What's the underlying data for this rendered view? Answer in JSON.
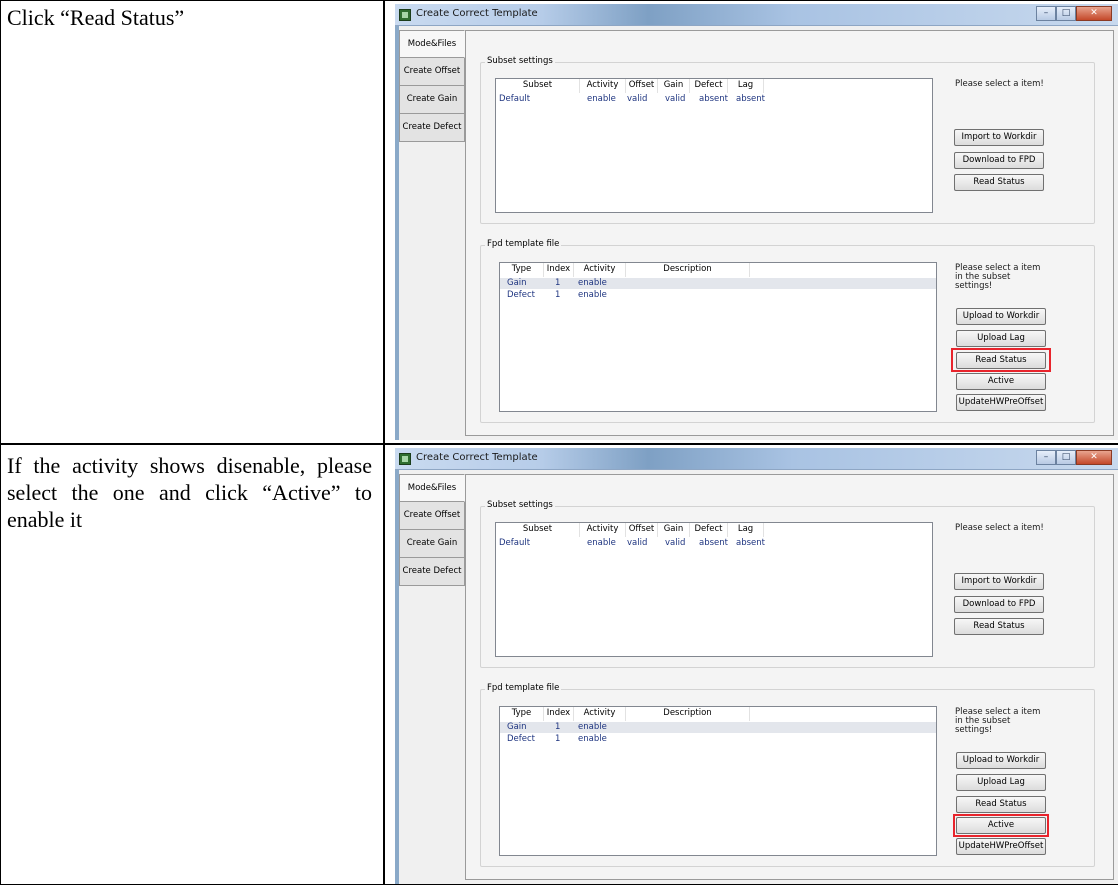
{
  "rows": [
    {
      "instruction": "Click “Read Status”"
    },
    {
      "instruction": "If the activity shows disenable, please select the one and click “Active” to enable it"
    }
  ],
  "window": {
    "title": "Create Correct Template",
    "controls": {
      "minimize": "–",
      "maximize": "□",
      "close": "✕"
    }
  },
  "sidebar": {
    "tabs": [
      "Mode&Files",
      "Create Offset",
      "Create Gain",
      "Create Defect"
    ],
    "active": "Mode&Files"
  },
  "subset_settings": {
    "title": "Subset settings",
    "columns": [
      "Subset",
      "Activity",
      "Offset",
      "Gain",
      "Defect",
      "Lag"
    ],
    "rows": [
      [
        "Default",
        "enable",
        "valid",
        "valid",
        "absent",
        "absent"
      ]
    ],
    "note": "Please select a item!",
    "buttons": [
      "Import to Workdir",
      "Download to FPD",
      "Read Status"
    ]
  },
  "fpd_template": {
    "title": "Fpd template file",
    "columns": [
      "Type",
      "Index",
      "Activity",
      "Description"
    ],
    "rows": [
      [
        "Gain",
        "1",
        "enable",
        ""
      ],
      [
        "Defect",
        "1",
        "enable",
        ""
      ]
    ],
    "note_lines": [
      "Please select a item",
      "in the subset",
      "settings!"
    ],
    "buttons": [
      "Upload to Workdir",
      "Upload Lag",
      "Read Status",
      "Active",
      "UpdateHWPreOffset"
    ]
  },
  "colors": {
    "highlight": "#e8242c",
    "list_text": "#1f3580",
    "title_bar": "#b7cde9"
  }
}
